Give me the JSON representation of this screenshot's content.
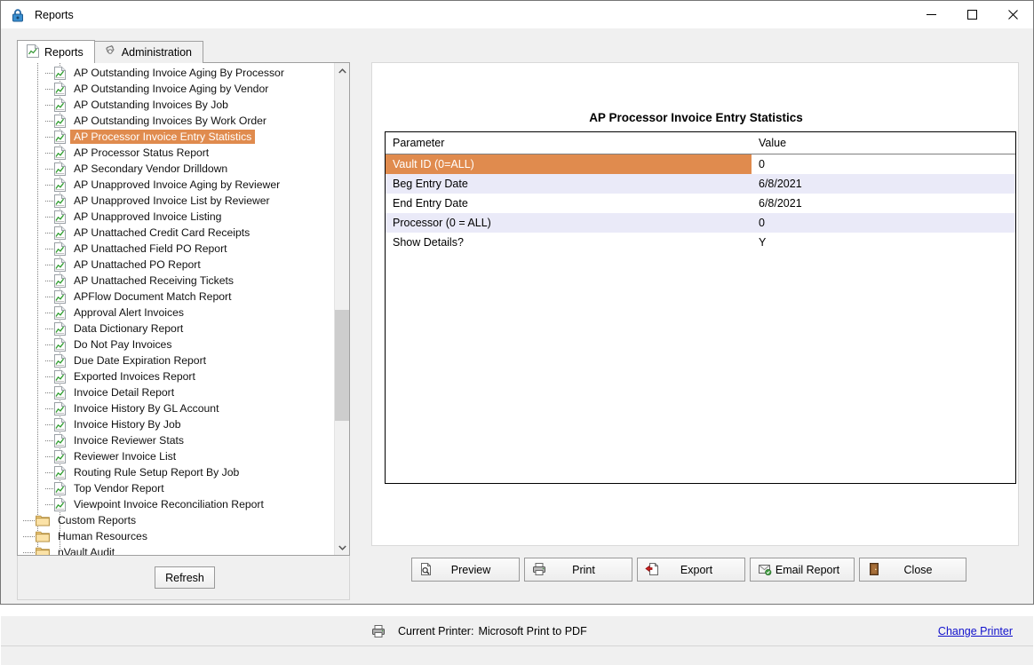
{
  "window": {
    "title": "Reports",
    "icon": "lock-icon",
    "controls": {
      "minimize": "minimize-icon",
      "maximize": "maximize-icon",
      "close": "close-icon"
    }
  },
  "tabs": [
    {
      "label": "Reports",
      "icon": "report-chart-icon",
      "active": true
    },
    {
      "label": "Administration",
      "icon": "gear-icon",
      "active": false
    }
  ],
  "sidebar": {
    "refresh_label": "Refresh",
    "tree": [
      {
        "label": "AP Outstanding Invoice Aging By Processor",
        "type": "report",
        "selected": false
      },
      {
        "label": "AP Outstanding Invoice Aging by Vendor",
        "type": "report",
        "selected": false
      },
      {
        "label": "AP Outstanding Invoices By Job",
        "type": "report",
        "selected": false
      },
      {
        "label": "AP Outstanding Invoices By Work Order",
        "type": "report",
        "selected": false
      },
      {
        "label": "AP Processor Invoice Entry Statistics",
        "type": "report",
        "selected": true
      },
      {
        "label": "AP Processor Status Report",
        "type": "report",
        "selected": false
      },
      {
        "label": "AP Secondary Vendor Drilldown",
        "type": "report",
        "selected": false
      },
      {
        "label": "AP Unapproved Invoice Aging by Reviewer",
        "type": "report",
        "selected": false
      },
      {
        "label": "AP Unapproved Invoice List by Reviewer",
        "type": "report",
        "selected": false
      },
      {
        "label": "AP Unapproved Invoice Listing",
        "type": "report",
        "selected": false
      },
      {
        "label": "AP Unattached Credit Card Receipts",
        "type": "report",
        "selected": false
      },
      {
        "label": "AP Unattached Field PO Report",
        "type": "report",
        "selected": false
      },
      {
        "label": "AP Unattached PO Report",
        "type": "report",
        "selected": false
      },
      {
        "label": "AP Unattached Receiving Tickets",
        "type": "report",
        "selected": false
      },
      {
        "label": "APFlow Document Match Report",
        "type": "report",
        "selected": false
      },
      {
        "label": "Approval Alert Invoices",
        "type": "report",
        "selected": false
      },
      {
        "label": "Data Dictionary Report",
        "type": "report",
        "selected": false
      },
      {
        "label": "Do Not Pay Invoices",
        "type": "report",
        "selected": false
      },
      {
        "label": "Due Date Expiration Report",
        "type": "report",
        "selected": false
      },
      {
        "label": "Exported Invoices Report",
        "type": "report",
        "selected": false
      },
      {
        "label": "Invoice Detail Report",
        "type": "report",
        "selected": false
      },
      {
        "label": "Invoice History By GL Account",
        "type": "report",
        "selected": false
      },
      {
        "label": "Invoice History By Job",
        "type": "report",
        "selected": false
      },
      {
        "label": "Invoice Reviewer Stats",
        "type": "report",
        "selected": false
      },
      {
        "label": "Reviewer Invoice List",
        "type": "report",
        "selected": false
      },
      {
        "label": "Routing Rule Setup Report By Job",
        "type": "report",
        "selected": false
      },
      {
        "label": "Top Vendor Report",
        "type": "report",
        "selected": false
      },
      {
        "label": "Viewpoint Invoice Reconciliation Report",
        "type": "report",
        "selected": false
      },
      {
        "label": "Custom Reports",
        "type": "folder",
        "selected": false
      },
      {
        "label": "Human Resources",
        "type": "folder",
        "selected": false
      },
      {
        "label": "nVault Audit",
        "type": "folder",
        "selected": false
      }
    ]
  },
  "report": {
    "title": "AP Processor Invoice Entry Statistics",
    "table": {
      "columns": [
        "Parameter",
        "Value"
      ],
      "rows": [
        {
          "parameter": "Vault ID (0=ALL)",
          "value": "0",
          "highlighted": true
        },
        {
          "parameter": "Beg Entry Date",
          "value": "6/8/2021",
          "highlighted": false
        },
        {
          "parameter": "End Entry Date",
          "value": "6/8/2021",
          "highlighted": false
        },
        {
          "parameter": "Processor (0 = ALL)",
          "value": "0",
          "highlighted": false
        },
        {
          "parameter": "Show Details?",
          "value": "Y",
          "highlighted": false
        }
      ]
    }
  },
  "actions": [
    {
      "label": "Preview",
      "icon": "preview-magnifier-icon"
    },
    {
      "label": "Print",
      "icon": "printer-icon"
    },
    {
      "label": "Export",
      "icon": "export-page-icon"
    },
    {
      "label": "Email Report",
      "icon": "email-envelope-icon"
    },
    {
      "label": "Close",
      "icon": "door-exit-icon"
    }
  ],
  "status": {
    "printer_icon": "printer-icon",
    "printer_label": "Current Printer:",
    "printer_name": "Microsoft Print to PDF",
    "change_printer_link": "Change Printer"
  },
  "colors": {
    "selection_orange": "#e08b4e",
    "alt_row": "#eaeaf8",
    "link_blue": "#1111cc"
  }
}
